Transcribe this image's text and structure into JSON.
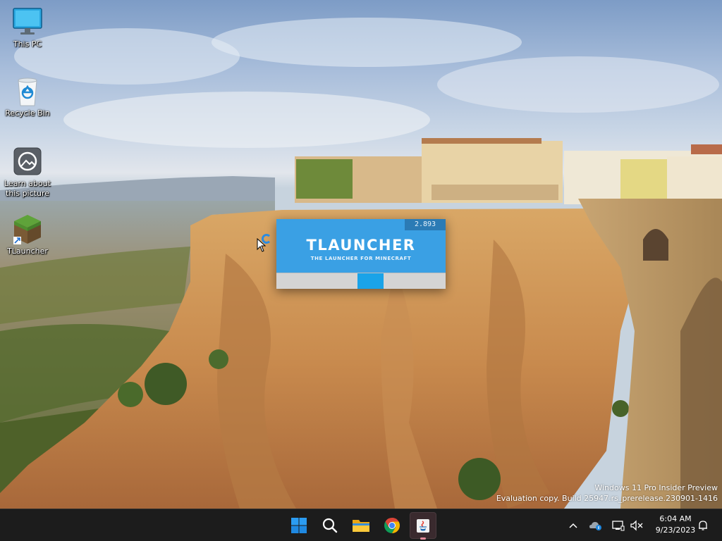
{
  "desktop": {
    "icons": [
      {
        "label": "This PC",
        "icon": "monitor-icon"
      },
      {
        "label": "Recycle Bin",
        "icon": "recycle-bin-icon"
      },
      {
        "label": "Learn about this picture",
        "icon": "camera-icon"
      },
      {
        "label": "TLauncher",
        "icon": "grass-block-icon"
      }
    ]
  },
  "splash": {
    "version": "2.893",
    "title": "TLAUNCHER",
    "subtitle": "THE LAUNCHER FOR MINECRAFT",
    "accent": "#3aa0e4",
    "progress_indicator": "indeterminate"
  },
  "watermark": {
    "line1": "Windows 11 Pro Insider Preview",
    "line2": "Evaluation copy. Build 25947.rs_prerelease.230901-1416"
  },
  "taskbar": {
    "apps": [
      {
        "name": "Start",
        "icon": "windows-start-icon"
      },
      {
        "name": "Search",
        "icon": "search-icon"
      },
      {
        "name": "File Explorer",
        "icon": "folder-icon"
      },
      {
        "name": "Google Chrome",
        "icon": "chrome-icon"
      },
      {
        "name": "Java",
        "icon": "java-icon",
        "active": true
      }
    ],
    "tray": {
      "time": "6:04 AM",
      "date": "9/23/2023"
    }
  }
}
